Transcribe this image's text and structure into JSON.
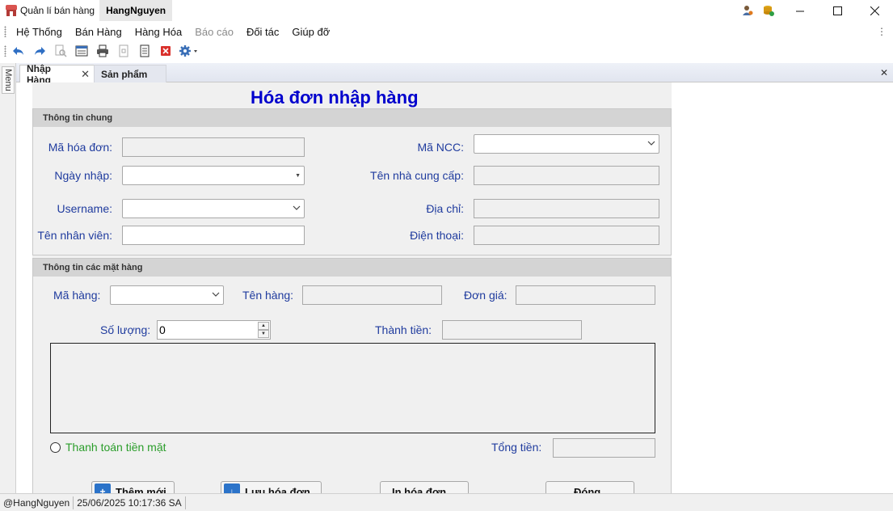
{
  "window": {
    "app_title": "Quản lí bán hàng",
    "user_tab": "HangNguyen"
  },
  "menu": [
    "Hệ Thống",
    "Bán Hàng",
    "Hàng Hóa",
    "Báo cáo",
    "Đối tác",
    "Giúp đỡ"
  ],
  "side_tab": "Menu",
  "tabs": [
    "Nhập Hàng",
    "Sản phẩm"
  ],
  "form": {
    "title": "Hóa đơn nhập hàng",
    "general": {
      "header": "Thông tin chung",
      "invoice_id_label": "Mã hóa đơn:",
      "import_date_label": "Ngày nhập:",
      "username_label": "Username:",
      "employee_name_label": "Tên nhân viên:",
      "supplier_id_label": "Mã NCC:",
      "supplier_name_label": "Tên nhà cung cấp:",
      "address_label": "Địa chỉ:",
      "phone_label": "Điện thoại:"
    },
    "items": {
      "header": "Thông tin các mặt hàng",
      "item_id_label": "Mã hàng:",
      "item_name_label": "Tên hàng:",
      "unit_price_label": "Đơn giá:",
      "quantity_label": "Số lượng:",
      "quantity_value": "0",
      "amount_label": "Thành tiền:"
    },
    "cash_payment_label": "Thanh toán tiền mặt",
    "total_label": "Tổng tiền:",
    "buttons": {
      "add": "Thêm mới",
      "save": "Lưu hóa đơn",
      "print": "In hóa đơn",
      "close": "Đóng"
    }
  },
  "status": {
    "user": "@HangNguyen",
    "datetime": "25/06/2025 10:17:36 SA"
  },
  "colors": {
    "title_blue": "#0000cd",
    "label_blue": "#1f3b9e",
    "label_green": "#2a9d2a",
    "form_bg": "#f0f0f0"
  }
}
